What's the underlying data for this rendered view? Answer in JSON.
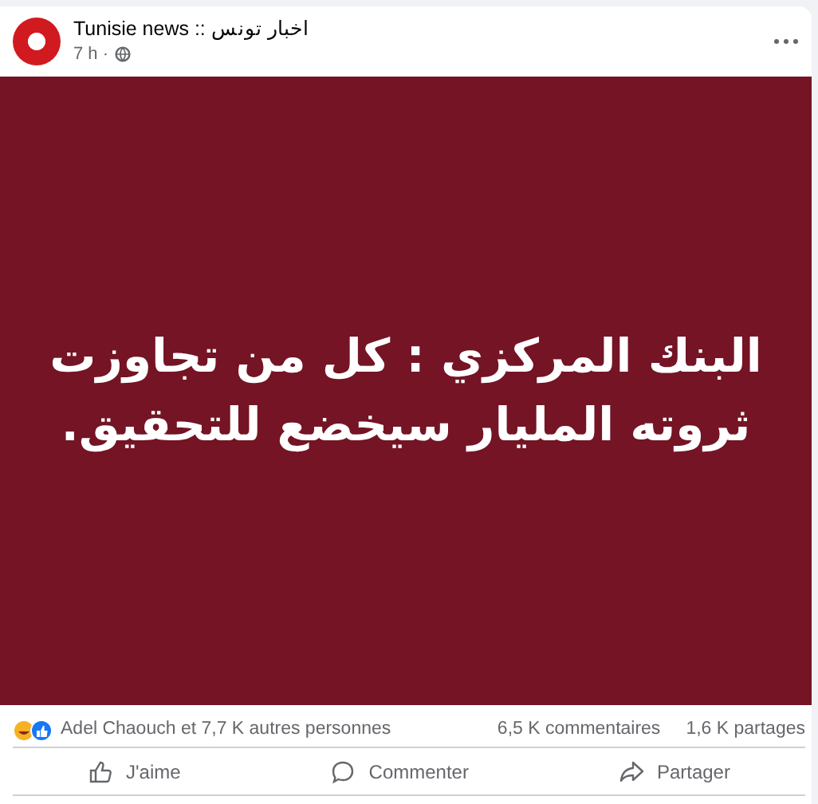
{
  "post": {
    "author": "Tunisie news :: اخبار تونس",
    "time": "7 h ·",
    "image_text": [
      "البنك المركزي : كل من تجاوزت",
      "ثروته المليار سيخضع للتحقيق."
    ],
    "reactions_text": "Adel Chaouch et 7,7 K autres personnes",
    "comments": "6,5 K commentaires",
    "shares": "1,6 K partages",
    "actions": [
      {
        "kind": "like",
        "label": "J'aime"
      },
      {
        "kind": "comment",
        "label": "Commenter"
      },
      {
        "kind": "share",
        "label": "Partager"
      }
    ]
  }
}
